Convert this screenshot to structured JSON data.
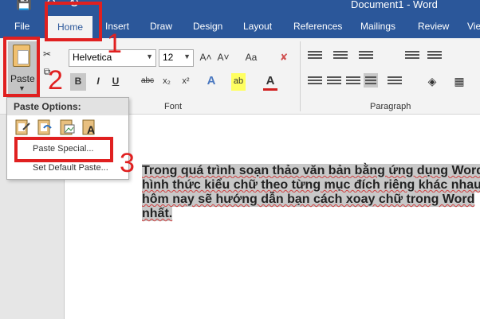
{
  "title_bar": {
    "doc_title": "Document1  -  Word",
    "qat_icons": [
      "save-icon",
      "undo-icon",
      "redo-icon"
    ]
  },
  "tabs": [
    "File",
    "Home",
    "Insert",
    "Draw",
    "Design",
    "Layout",
    "References",
    "Mailings",
    "Review",
    "Viev"
  ],
  "active_tab": "Home",
  "ribbon": {
    "paste_label": "Paste",
    "font_name": "Helvetica",
    "font_size": "12",
    "font_group_label": "Font",
    "paragraph_group_label": "Paragraph",
    "bold": "B",
    "italic": "I",
    "underline": "U",
    "strike": "abc",
    "subscript": "x₂",
    "superscript": "x²",
    "grow": "A˄",
    "shrink": "A˅",
    "case": "Aa",
    "font_color": "A",
    "text_effects": "A",
    "highlight": "ab"
  },
  "paste_options": {
    "header": "Paste Options:",
    "paste_special": "Paste Special...",
    "set_default": "Set Default Paste..."
  },
  "document": {
    "lines": [
      "Trong quá trình soạn thảo văn bản bằng ứng dụng Word",
      "hình thức kiểu chữ theo từng mục đích riêng khác nhau",
      "hôm nay sẽ hướng dẫn bạn cách xoay chữ trong Word",
      "nhất."
    ]
  },
  "annotations": {
    "step1": "1",
    "step2": "2",
    "step3": "3",
    "color": "#e02020"
  },
  "colors": {
    "ribbon_blue": "#2b579a",
    "ribbon_bg": "#f3f3f3"
  }
}
